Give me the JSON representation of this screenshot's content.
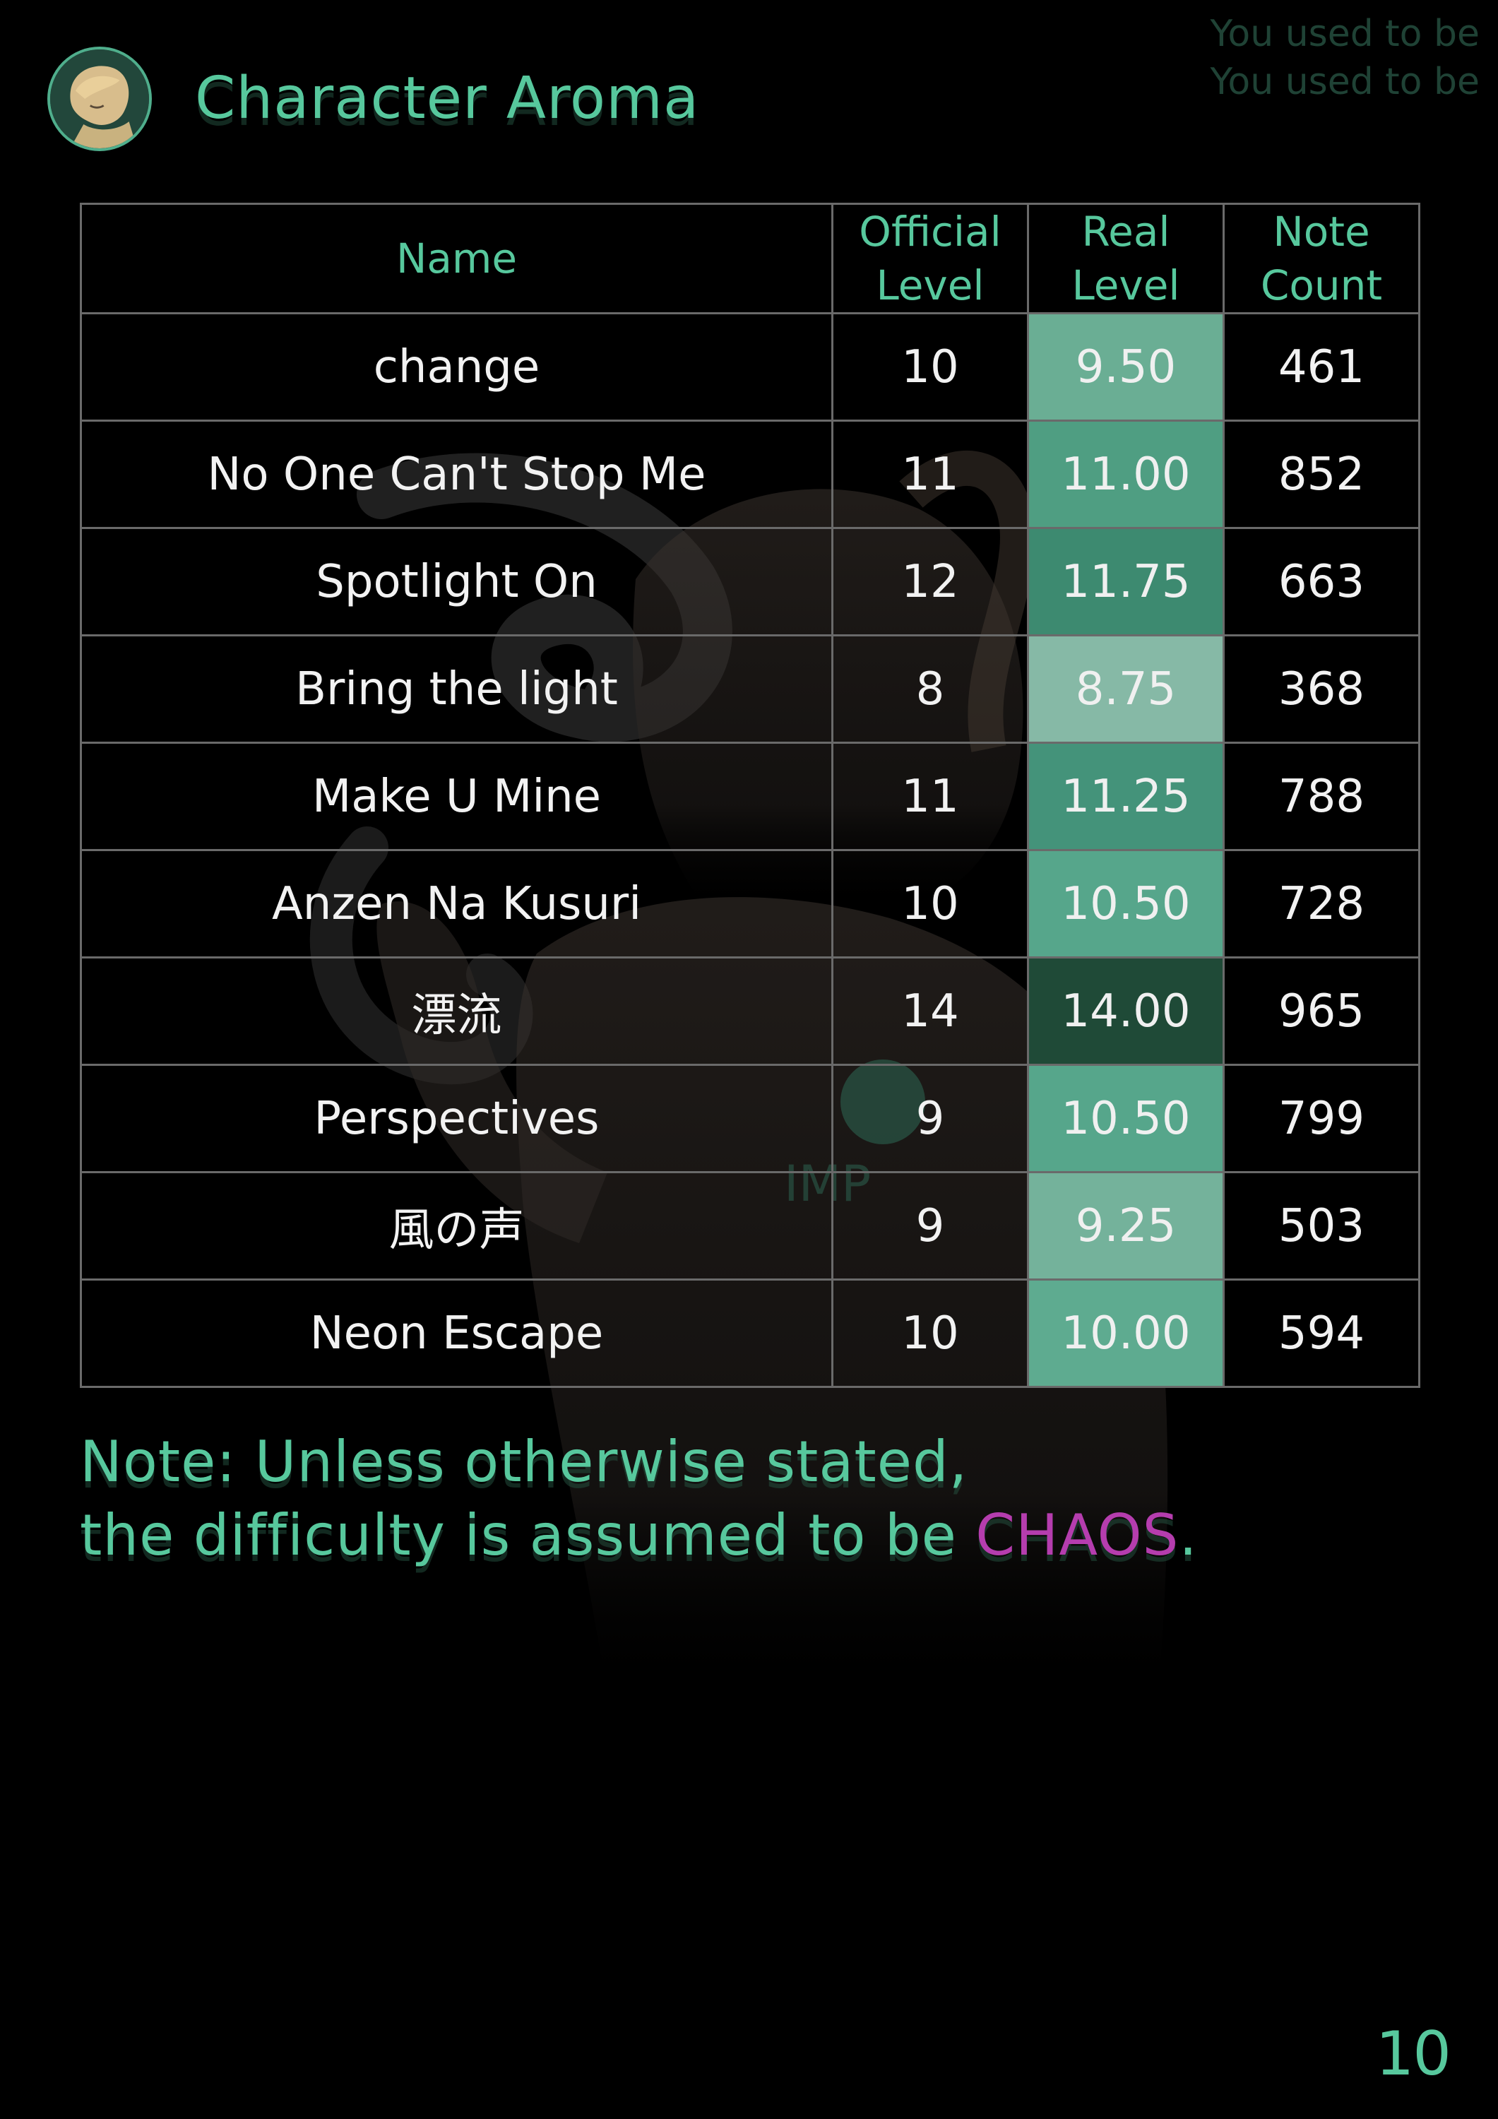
{
  "header": {
    "title": "Character Aroma",
    "watermark": [
      "You used to be",
      "You used to be"
    ]
  },
  "table": {
    "columns": [
      {
        "line1": "Name",
        "line2": ""
      },
      {
        "line1": "Official",
        "line2": "Level"
      },
      {
        "line1": "Real",
        "line2": "Level"
      },
      {
        "line1": "Note",
        "line2": "Count"
      }
    ],
    "rows": [
      {
        "name": "change",
        "official": "10",
        "real": "9.50",
        "notes": "461",
        "real_color": "#6aae94"
      },
      {
        "name": "No One Can't Stop Me",
        "official": "11",
        "real": "11.00",
        "notes": "852",
        "real_color": "#4f9e82"
      },
      {
        "name": "Spotlight On",
        "official": "12",
        "real": "11.75",
        "notes": "663",
        "real_color": "#3d8a70"
      },
      {
        "name": "Bring the light",
        "official": "8",
        "real": "8.75",
        "notes": "368",
        "real_color": "#86b9a6"
      },
      {
        "name": "Make U Mine",
        "official": "11",
        "real": "11.25",
        "notes": "788",
        "real_color": "#44937a"
      },
      {
        "name": "Anzen Na Kusuri",
        "official": "10",
        "real": "10.50",
        "notes": "728",
        "real_color": "#56a68b"
      },
      {
        "name": "漂流",
        "official": "14",
        "real": "14.00",
        "notes": "965",
        "real_color": "#1f4a37"
      },
      {
        "name": "Perspectives",
        "official": "9",
        "real": "10.50",
        "notes": "799",
        "real_color": "#56a68b"
      },
      {
        "name": "風の声",
        "official": "9",
        "real": "9.25",
        "notes": "503",
        "real_color": "#74b29b"
      },
      {
        "name": "Neon Escape",
        "official": "10",
        "real": "10.00",
        "notes": "594",
        "real_color": "#5eab90"
      }
    ]
  },
  "note": {
    "line1": "Note: Unless otherwise stated,",
    "line2_prefix": "the difficulty is assumed to be ",
    "line2_highlight": "CHAOS",
    "line2_suffix": ".",
    "highlight_color": "#b53dae"
  },
  "page_number": "10"
}
